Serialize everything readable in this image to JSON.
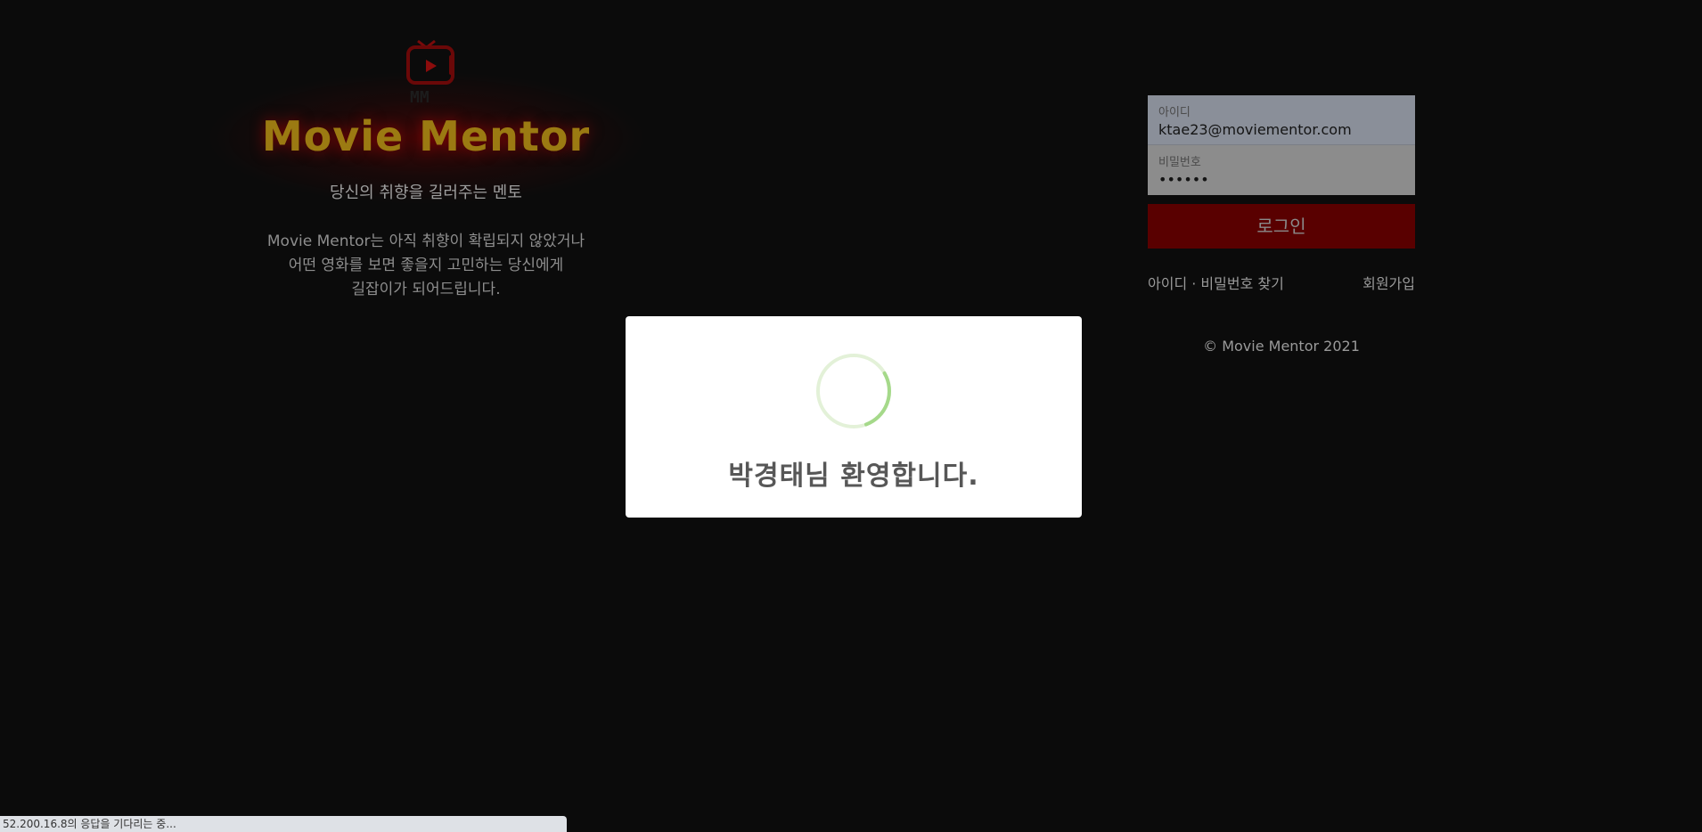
{
  "brand": {
    "logo_text": "MM",
    "title": "Movie Mentor",
    "tagline": "당신의 취향을 길러주는 멘토",
    "description": "Movie Mentor는 아직 취향이 확립되지 않았거나\n어떤 영화를 보면 좋을지 고민하는 당신에게\n길잡이가 되어드립니다."
  },
  "login": {
    "id_label": "아이디",
    "id_value": "ktae23@moviementor.com",
    "password_label": "비밀번호",
    "password_value": "••••••",
    "submit_label": "로그인",
    "find_link": "아이디 · 비밀번호 찾기",
    "signup_link": "회원가입",
    "copyright": "© Movie Mentor 2021"
  },
  "modal": {
    "message": "박경태님 환영합니다."
  },
  "status_bar": {
    "text": "52.200.16.8의 응답을 기다리는 중..."
  },
  "colors": {
    "background": "#0b0b0b",
    "brand_gold": "#9b7a12",
    "login_button": "#590000",
    "spinner_track": "#e3f1d8",
    "spinner_arc": "#a5d98a"
  },
  "icons": {
    "logo": "tv-play-icon",
    "spinner": "loading-spinner-icon"
  }
}
